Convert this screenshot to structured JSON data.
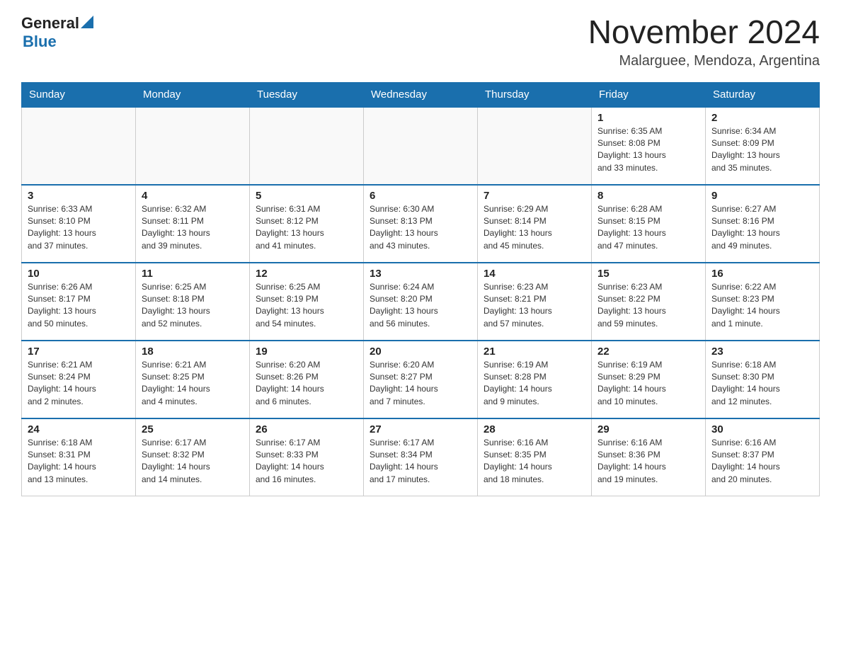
{
  "logo": {
    "text_general": "General",
    "text_arrow": "▲",
    "text_blue": "Blue"
  },
  "title": "November 2024",
  "subtitle": "Malarguee, Mendoza, Argentina",
  "weekdays": [
    "Sunday",
    "Monday",
    "Tuesday",
    "Wednesday",
    "Thursday",
    "Friday",
    "Saturday"
  ],
  "weeks": [
    [
      {
        "day": "",
        "info": ""
      },
      {
        "day": "",
        "info": ""
      },
      {
        "day": "",
        "info": ""
      },
      {
        "day": "",
        "info": ""
      },
      {
        "day": "",
        "info": ""
      },
      {
        "day": "1",
        "info": "Sunrise: 6:35 AM\nSunset: 8:08 PM\nDaylight: 13 hours\nand 33 minutes."
      },
      {
        "day": "2",
        "info": "Sunrise: 6:34 AM\nSunset: 8:09 PM\nDaylight: 13 hours\nand 35 minutes."
      }
    ],
    [
      {
        "day": "3",
        "info": "Sunrise: 6:33 AM\nSunset: 8:10 PM\nDaylight: 13 hours\nand 37 minutes."
      },
      {
        "day": "4",
        "info": "Sunrise: 6:32 AM\nSunset: 8:11 PM\nDaylight: 13 hours\nand 39 minutes."
      },
      {
        "day": "5",
        "info": "Sunrise: 6:31 AM\nSunset: 8:12 PM\nDaylight: 13 hours\nand 41 minutes."
      },
      {
        "day": "6",
        "info": "Sunrise: 6:30 AM\nSunset: 8:13 PM\nDaylight: 13 hours\nand 43 minutes."
      },
      {
        "day": "7",
        "info": "Sunrise: 6:29 AM\nSunset: 8:14 PM\nDaylight: 13 hours\nand 45 minutes."
      },
      {
        "day": "8",
        "info": "Sunrise: 6:28 AM\nSunset: 8:15 PM\nDaylight: 13 hours\nand 47 minutes."
      },
      {
        "day": "9",
        "info": "Sunrise: 6:27 AM\nSunset: 8:16 PM\nDaylight: 13 hours\nand 49 minutes."
      }
    ],
    [
      {
        "day": "10",
        "info": "Sunrise: 6:26 AM\nSunset: 8:17 PM\nDaylight: 13 hours\nand 50 minutes."
      },
      {
        "day": "11",
        "info": "Sunrise: 6:25 AM\nSunset: 8:18 PM\nDaylight: 13 hours\nand 52 minutes."
      },
      {
        "day": "12",
        "info": "Sunrise: 6:25 AM\nSunset: 8:19 PM\nDaylight: 13 hours\nand 54 minutes."
      },
      {
        "day": "13",
        "info": "Sunrise: 6:24 AM\nSunset: 8:20 PM\nDaylight: 13 hours\nand 56 minutes."
      },
      {
        "day": "14",
        "info": "Sunrise: 6:23 AM\nSunset: 8:21 PM\nDaylight: 13 hours\nand 57 minutes."
      },
      {
        "day": "15",
        "info": "Sunrise: 6:23 AM\nSunset: 8:22 PM\nDaylight: 13 hours\nand 59 minutes."
      },
      {
        "day": "16",
        "info": "Sunrise: 6:22 AM\nSunset: 8:23 PM\nDaylight: 14 hours\nand 1 minute."
      }
    ],
    [
      {
        "day": "17",
        "info": "Sunrise: 6:21 AM\nSunset: 8:24 PM\nDaylight: 14 hours\nand 2 minutes."
      },
      {
        "day": "18",
        "info": "Sunrise: 6:21 AM\nSunset: 8:25 PM\nDaylight: 14 hours\nand 4 minutes."
      },
      {
        "day": "19",
        "info": "Sunrise: 6:20 AM\nSunset: 8:26 PM\nDaylight: 14 hours\nand 6 minutes."
      },
      {
        "day": "20",
        "info": "Sunrise: 6:20 AM\nSunset: 8:27 PM\nDaylight: 14 hours\nand 7 minutes."
      },
      {
        "day": "21",
        "info": "Sunrise: 6:19 AM\nSunset: 8:28 PM\nDaylight: 14 hours\nand 9 minutes."
      },
      {
        "day": "22",
        "info": "Sunrise: 6:19 AM\nSunset: 8:29 PM\nDaylight: 14 hours\nand 10 minutes."
      },
      {
        "day": "23",
        "info": "Sunrise: 6:18 AM\nSunset: 8:30 PM\nDaylight: 14 hours\nand 12 minutes."
      }
    ],
    [
      {
        "day": "24",
        "info": "Sunrise: 6:18 AM\nSunset: 8:31 PM\nDaylight: 14 hours\nand 13 minutes."
      },
      {
        "day": "25",
        "info": "Sunrise: 6:17 AM\nSunset: 8:32 PM\nDaylight: 14 hours\nand 14 minutes."
      },
      {
        "day": "26",
        "info": "Sunrise: 6:17 AM\nSunset: 8:33 PM\nDaylight: 14 hours\nand 16 minutes."
      },
      {
        "day": "27",
        "info": "Sunrise: 6:17 AM\nSunset: 8:34 PM\nDaylight: 14 hours\nand 17 minutes."
      },
      {
        "day": "28",
        "info": "Sunrise: 6:16 AM\nSunset: 8:35 PM\nDaylight: 14 hours\nand 18 minutes."
      },
      {
        "day": "29",
        "info": "Sunrise: 6:16 AM\nSunset: 8:36 PM\nDaylight: 14 hours\nand 19 minutes."
      },
      {
        "day": "30",
        "info": "Sunrise: 6:16 AM\nSunset: 8:37 PM\nDaylight: 14 hours\nand 20 minutes."
      }
    ]
  ]
}
